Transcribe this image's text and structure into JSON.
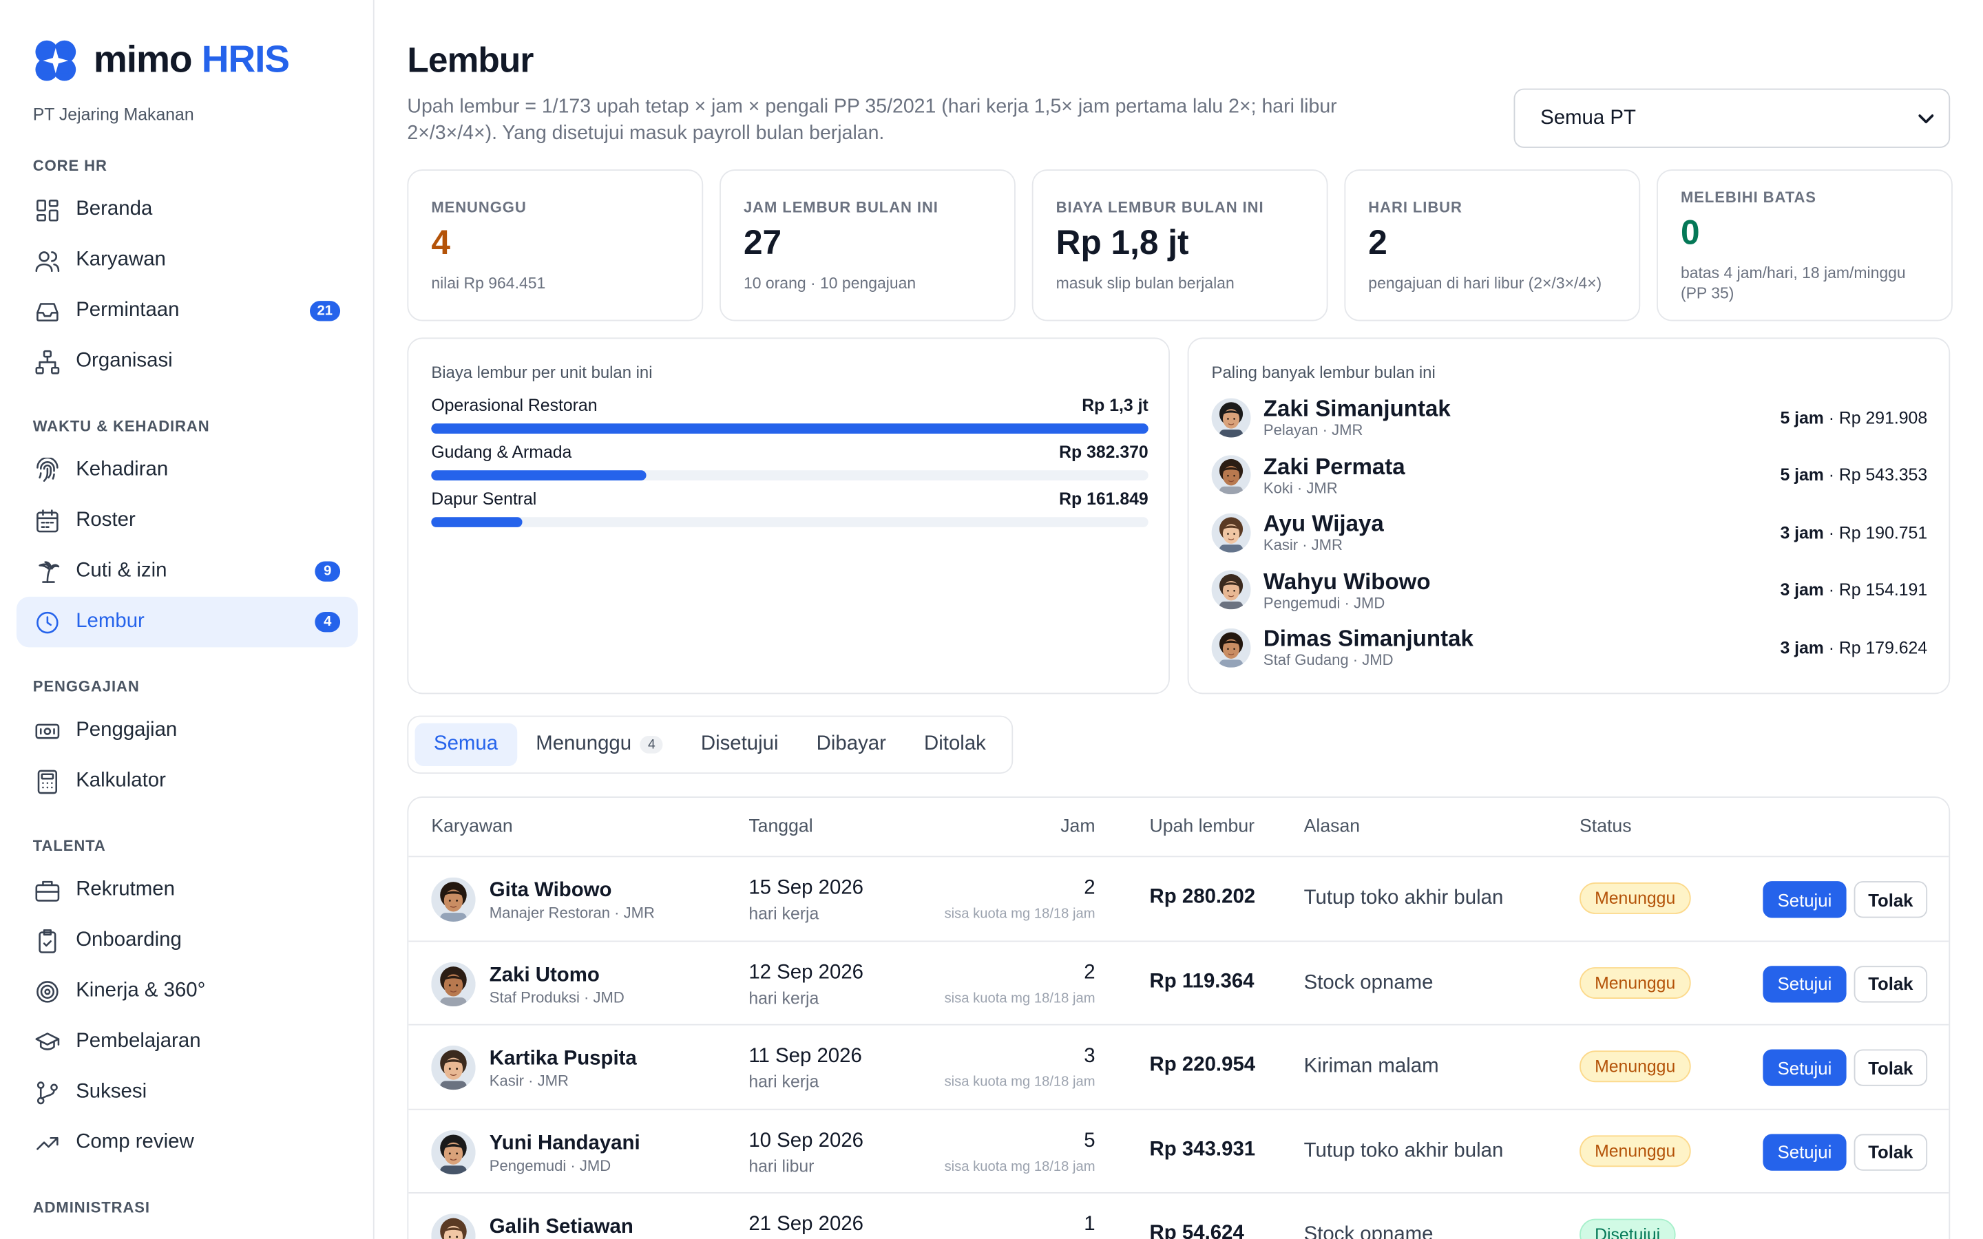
{
  "brand": {
    "name": "mimo",
    "suffix": "HRIS",
    "company": "PT Jejaring Makanan"
  },
  "colors": {
    "accent": "#2563eb",
    "warning": "#b45309",
    "success": "#047857"
  },
  "sidebar": {
    "sections": [
      {
        "title": "CORE HR",
        "items": [
          {
            "label": "Beranda",
            "icon": "grid-icon"
          },
          {
            "label": "Karyawan",
            "icon": "users-icon"
          },
          {
            "label": "Permintaan",
            "icon": "inbox-icon",
            "badge": "21"
          },
          {
            "label": "Organisasi",
            "icon": "org-chart-icon"
          }
        ]
      },
      {
        "title": "WAKTU & KEHADIRAN",
        "items": [
          {
            "label": "Kehadiran",
            "icon": "fingerprint-icon"
          },
          {
            "label": "Roster",
            "icon": "calendar-icon"
          },
          {
            "label": "Cuti & izin",
            "icon": "palm-tree-icon",
            "badge": "9"
          },
          {
            "label": "Lembur",
            "icon": "clock-icon",
            "badge": "4",
            "active": true
          }
        ]
      },
      {
        "title": "PENGGAJIAN",
        "items": [
          {
            "label": "Penggajian",
            "icon": "banknote-icon"
          },
          {
            "label": "Kalkulator",
            "icon": "calculator-icon"
          }
        ]
      },
      {
        "title": "TALENTA",
        "items": [
          {
            "label": "Rekrutmen",
            "icon": "briefcase-icon"
          },
          {
            "label": "Onboarding",
            "icon": "clipboard-check-icon"
          },
          {
            "label": "Kinerja & 360°",
            "icon": "target-icon"
          },
          {
            "label": "Pembelajaran",
            "icon": "graduation-cap-icon"
          },
          {
            "label": "Suksesi",
            "icon": "git-branch-icon"
          },
          {
            "label": "Comp review",
            "icon": "trending-up-icon"
          }
        ]
      },
      {
        "title": "ADMINISTRASI",
        "items": []
      }
    ]
  },
  "page": {
    "title": "Lembur",
    "description": "Upah lembur = 1/173 upah tetap × jam × pengali PP 35/2021 (hari kerja 1,5× jam pertama lalu 2×; hari libur 2×/3×/4×). Yang disetujui masuk payroll bulan berjalan.",
    "filter": {
      "selected": "Semua PT"
    }
  },
  "stats": [
    {
      "label": "MENUNGGU",
      "value": "4",
      "sub": "nilai Rp 964.451",
      "color": "#b45309"
    },
    {
      "label": "JAM LEMBUR BULAN INI",
      "value": "27",
      "sub": "10 orang · 10 pengajuan",
      "color": "#111827"
    },
    {
      "label": "BIAYA LEMBUR BULAN INI",
      "value": "Rp 1,8 jt",
      "sub": "masuk slip bulan berjalan",
      "color": "#111827"
    },
    {
      "label": "HARI LIBUR",
      "value": "2",
      "sub": "pengajuan di hari libur (2×/3×/4×)",
      "color": "#111827"
    },
    {
      "label": "MELEBIHI BATAS",
      "value": "0",
      "sub": "batas 4 jam/hari, 18 jam/minggu (PP 35)",
      "color": "#047857"
    }
  ],
  "cost_by_unit": {
    "title": "Biaya lembur per unit bulan ini",
    "rows": [
      {
        "unit": "Operasional Restoran",
        "amount": "Rp 1,3 jt",
        "share": 1.0
      },
      {
        "unit": "Gudang & Armada",
        "amount": "Rp 382.370",
        "share": 0.3
      },
      {
        "unit": "Dapur Sentral",
        "amount": "Rp 161.849",
        "share": 0.127
      }
    ]
  },
  "top_overtime": {
    "title": "Paling banyak lembur bulan ini",
    "rows": [
      {
        "name": "Zaki Simanjuntak",
        "role": "Pelayan · JMR",
        "hours": "5 jam",
        "amount": " · Rp 291.908"
      },
      {
        "name": "Zaki Permata",
        "role": "Koki · JMR",
        "hours": "5 jam",
        "amount": " · Rp 543.353"
      },
      {
        "name": "Ayu Wijaya",
        "role": "Kasir · JMR",
        "hours": "3 jam",
        "amount": " · Rp 190.751"
      },
      {
        "name": "Wahyu Wibowo",
        "role": "Pengemudi · JMD",
        "hours": "3 jam",
        "amount": " · Rp 154.191"
      },
      {
        "name": "Dimas Simanjuntak",
        "role": "Staf Gudang · JMD",
        "hours": "3 jam",
        "amount": " · Rp 179.624"
      }
    ]
  },
  "tabs": [
    {
      "label": "Semua",
      "active": true
    },
    {
      "label": "Menunggu",
      "count": "4"
    },
    {
      "label": "Disetujui"
    },
    {
      "label": "Dibayar"
    },
    {
      "label": "Ditolak"
    }
  ],
  "table": {
    "headers": {
      "employee": "Karyawan",
      "date": "Tanggal",
      "hours": "Jam",
      "pay": "Upah lembur",
      "reason": "Alasan",
      "status": "Status"
    },
    "approve_label": "Setujui",
    "reject_label": "Tolak",
    "rows": [
      {
        "name": "Gita Wibowo",
        "role": "Manajer Restoran · JMR",
        "date": "15 Sep 2026",
        "day_type": "hari kerja",
        "hours": "2",
        "quota": "sisa kuota mg 18/18 jam",
        "pay": "Rp 280.202",
        "reason": "Tutup toko akhir bulan",
        "status": "Menunggu"
      },
      {
        "name": "Zaki Utomo",
        "role": "Staf Produksi · JMD",
        "date": "12 Sep 2026",
        "day_type": "hari kerja",
        "hours": "2",
        "quota": "sisa kuota mg 18/18 jam",
        "pay": "Rp 119.364",
        "reason": "Stock opname",
        "status": "Menunggu"
      },
      {
        "name": "Kartika Puspita",
        "role": "Kasir · JMR",
        "date": "11 Sep 2026",
        "day_type": "hari kerja",
        "hours": "3",
        "quota": "sisa kuota mg 18/18 jam",
        "pay": "Rp 220.954",
        "reason": "Kiriman malam",
        "status": "Menunggu"
      },
      {
        "name": "Yuni Handayani",
        "role": "Pengemudi · JMD",
        "date": "10 Sep 2026",
        "day_type": "hari libur",
        "hours": "5",
        "quota": "sisa kuota mg 18/18 jam",
        "pay": "Rp 343.931",
        "reason": "Tutup toko akhir bulan",
        "status": "Menunggu"
      },
      {
        "name": "Galih Setiawan",
        "role": "",
        "date": "21 Sep 2026",
        "day_type": "",
        "hours": "1",
        "quota": "",
        "pay": "Rp 54.624",
        "reason": "Stock opname",
        "status": "Disetujui"
      }
    ]
  }
}
